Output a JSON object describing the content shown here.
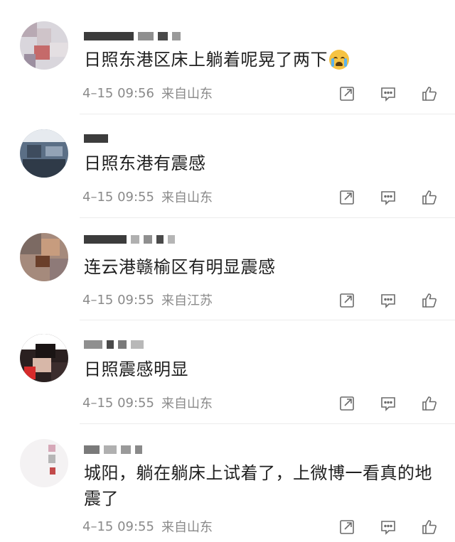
{
  "comments": [
    {
      "text": "日照东港区床上躺着呢晃了两下",
      "emoji": "crying-face-icon",
      "date": "4–15 09:56",
      "location": "来自山东"
    },
    {
      "text": "日照东港有震感",
      "date": "4–15 09:55",
      "location": "来自山东"
    },
    {
      "text": "连云港赣榆区有明显震感",
      "date": "4–15 09:55",
      "location": "来自江苏"
    },
    {
      "text": "日照震感明显",
      "date": "4–15 09:55",
      "location": "来自山东"
    },
    {
      "text": "城阳，躺在躺床上试着了，上微博一看真的地震了",
      "date": "4–15 09:55",
      "location": "来自山东"
    }
  ],
  "icons": {
    "share": "share-icon",
    "comment": "comment-icon",
    "like": "thumbs-up-icon"
  },
  "colors": {
    "text": "#1f1f1f",
    "meta": "#8a8a8a",
    "icon": "#6b6b6b"
  }
}
